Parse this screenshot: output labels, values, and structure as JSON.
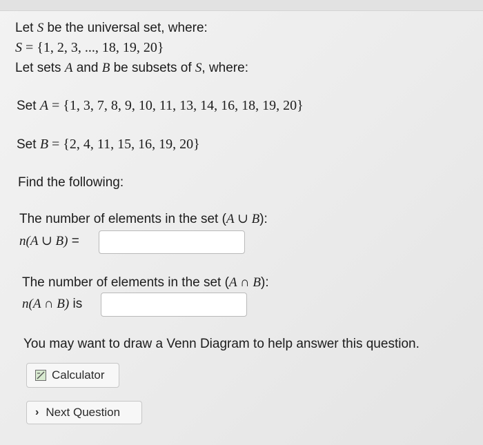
{
  "intro": {
    "line1_prefix": "Let ",
    "line1_var": "S",
    "line1_suffix": " be the universal set, where:",
    "line2_var": "S",
    "line2_eq": " = {1, 2, 3, ..., 18, 19, 20}",
    "line3_prefix": "Let sets ",
    "line3_a": "A",
    "line3_and": " and ",
    "line3_b": "B",
    "line3_mid": " be subsets of ",
    "line3_s": "S",
    "line3_suffix": ", where:"
  },
  "sets": {
    "a_label": "Set ",
    "a_var": "A",
    "a_value": " = {1, 3, 7, 8, 9, 10, 11, 13, 14, 16, 18, 19, 20}",
    "b_label": "Set ",
    "b_var": "B",
    "b_value": " = {2, 4, 11, 15, 16, 19, 20}"
  },
  "find_label": "Find the following:",
  "q1": {
    "text_prefix": "The number of elements in the set (",
    "expr": "A ∪ B",
    "text_suffix": "):",
    "answer_label": "n(A ∪ B)",
    "answer_suffix": " =",
    "answer_value": ""
  },
  "q2": {
    "text_prefix": "The number of elements in the set (",
    "expr": "A ∩ B",
    "text_suffix": "):",
    "answer_label": "n(A ∩ B)",
    "answer_suffix": " is",
    "answer_value": ""
  },
  "hint": "You may want to draw a Venn Diagram to help answer this question.",
  "buttons": {
    "calculator": "Calculator",
    "next": "Next Question",
    "calculator_icon": "calculator-icon",
    "next_icon": "chevron-right-icon"
  }
}
